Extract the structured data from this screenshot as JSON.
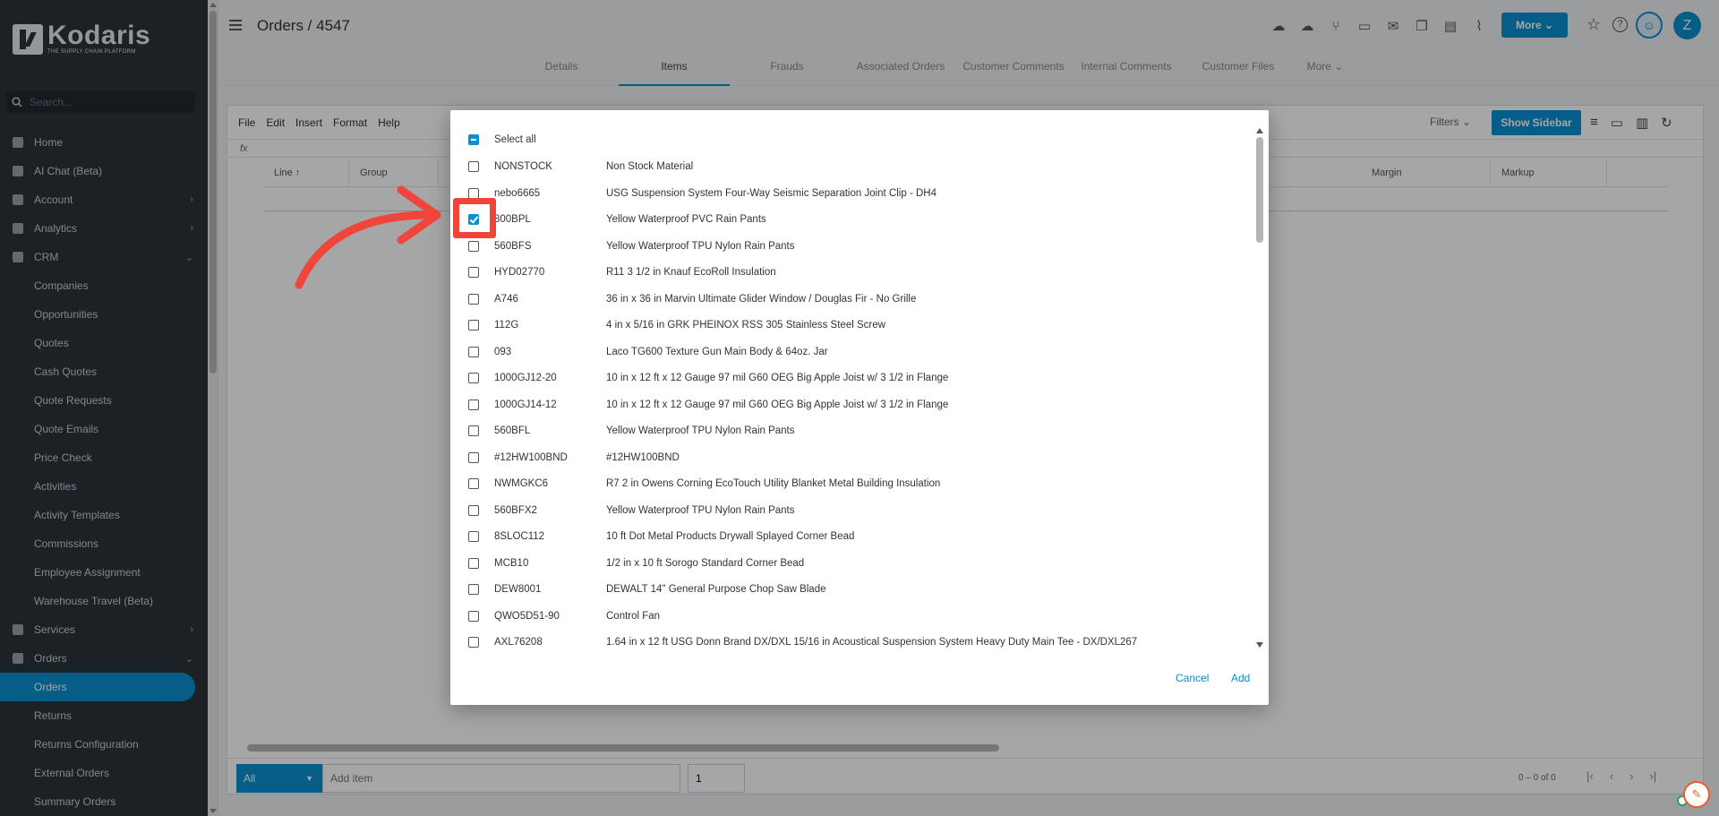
{
  "brand": {
    "name": "Kodaris",
    "tagline": "THE SUPPLY CHAIN PLATFORM"
  },
  "search": {
    "placeholder": "Search..."
  },
  "nav": [
    {
      "label": "Home",
      "icon": "home-icon",
      "chevron": ""
    },
    {
      "label": "AI Chat (Beta)",
      "icon": "robot-icon",
      "chevron": ""
    },
    {
      "label": "Account",
      "icon": "user-icon",
      "chevron": "›"
    },
    {
      "label": "Analytics",
      "icon": "chart-icon",
      "chevron": "›"
    },
    {
      "label": "CRM",
      "icon": "crm-icon",
      "chevron": "⌄"
    },
    {
      "label": "Companies",
      "sub": true
    },
    {
      "label": "Opportunities",
      "sub": true
    },
    {
      "label": "Quotes",
      "sub": true
    },
    {
      "label": "Cash Quotes",
      "sub": true
    },
    {
      "label": "Quote Requests",
      "sub": true
    },
    {
      "label": "Quote Emails",
      "sub": true
    },
    {
      "label": "Price Check",
      "sub": true
    },
    {
      "label": "Activities",
      "sub": true
    },
    {
      "label": "Activity Templates",
      "sub": true
    },
    {
      "label": "Commissions",
      "sub": true
    },
    {
      "label": "Employee Assignment",
      "sub": true
    },
    {
      "label": "Warehouse Travel (Beta)",
      "sub": true
    },
    {
      "label": "Services",
      "icon": "services-icon",
      "chevron": "›"
    },
    {
      "label": "Orders",
      "icon": "car-icon",
      "chevron": "⌄"
    },
    {
      "label": "Orders",
      "sub": true,
      "active": true
    },
    {
      "label": "Returns",
      "sub": true
    },
    {
      "label": "Returns Configuration",
      "sub": true
    },
    {
      "label": "External Orders",
      "sub": true
    },
    {
      "label": "Summary Orders",
      "sub": true
    }
  ],
  "header": {
    "title": "Orders / 4547",
    "more_label": "More",
    "avatar": "Z"
  },
  "tabs": [
    "Details",
    "Items",
    "Frauds",
    "Associated Orders",
    "Customer Comments",
    "Internal Comments",
    "Customer Files",
    "More"
  ],
  "active_tab": "Items",
  "menubar": [
    "File",
    "Edit",
    "Insert",
    "Format",
    "Help"
  ],
  "toolbar": {
    "filters_label": "Filters",
    "show_sidebar_label": "Show Sidebar"
  },
  "formula_bar": {
    "label": "fx"
  },
  "grid": {
    "columns": [
      "Line",
      "Group",
      "Margin",
      "Markup"
    ]
  },
  "bottom": {
    "select_label": "All",
    "add_item_placeholder": "Add item",
    "qty_value": "1",
    "pager_text": "0 – 0 of 0"
  },
  "modal": {
    "select_all_label": "Select all",
    "cancel_label": "Cancel",
    "add_label": "Add",
    "items": [
      {
        "code": "NONSTOCK",
        "desc": "Non Stock Material",
        "checked": false
      },
      {
        "code": "nebo6665",
        "desc": "USG Suspension System Four-Way Seismic Separation Joint Clip - DH4",
        "checked": false
      },
      {
        "code": "800BPL",
        "desc": "Yellow Waterproof PVC Rain Pants",
        "checked": true
      },
      {
        "code": "560BFS",
        "desc": "Yellow Waterproof TPU Nylon Rain Pants",
        "checked": false
      },
      {
        "code": "HYD02770",
        "desc": "R11 3 1/2 in Knauf EcoRoll Insulation",
        "checked": false
      },
      {
        "code": "A746",
        "desc": "36 in x 36 in Marvin Ultimate Glider Window / Douglas Fir - No Grille",
        "checked": false
      },
      {
        "code": "112G",
        "desc": "4 in x 5/16 in GRK PHEINOX RSS 305 Stainless Steel Screw",
        "checked": false
      },
      {
        "code": "093",
        "desc": "Laco TG600 Texture Gun Main Body & 64oz. Jar",
        "checked": false
      },
      {
        "code": "1000GJ12-20",
        "desc": "10 in x 12 ft x 12 Gauge 97 mil G60 OEG Big Apple Joist w/ 3 1/2 in Flange",
        "checked": false
      },
      {
        "code": "1000GJ14-12",
        "desc": "10 in x 12 ft x 12 Gauge 97 mil G60 OEG Big Apple Joist w/ 3 1/2 in Flange",
        "checked": false
      },
      {
        "code": "560BFL",
        "desc": "Yellow Waterproof TPU Nylon Rain Pants",
        "checked": false
      },
      {
        "code": "#12HW100BND",
        "desc": "#12HW100BND",
        "checked": false
      },
      {
        "code": "NWMGKC6",
        "desc": "R7 2 in Owens Corning EcoTouch Utility Blanket Metal Building Insulation",
        "checked": false
      },
      {
        "code": "560BFX2",
        "desc": "Yellow Waterproof TPU Nylon Rain Pants",
        "checked": false
      },
      {
        "code": "8SLOC112",
        "desc": "10 ft Dot Metal Products Drywall Splayed Corner Bead",
        "checked": false
      },
      {
        "code": "MCB10",
        "desc": "1/2 in x 10 ft Sorogo Standard Corner Bead",
        "checked": false
      },
      {
        "code": "DEW8001",
        "desc": "DEWALT 14\" General Purpose Chop Saw Blade",
        "checked": false
      },
      {
        "code": "QWO5D51-90",
        "desc": "Control Fan",
        "checked": false
      },
      {
        "code": "AXL76208",
        "desc": "1.64 in x 12 ft USG Donn Brand DX/DXL 15/16 in Acoustical Suspension System Heavy Duty Main Tee - DX/DXL267",
        "checked": false
      }
    ]
  },
  "colors": {
    "accent": "#0a8fd0",
    "sidebar": "#2c333b",
    "highlight": "#f0453a"
  }
}
